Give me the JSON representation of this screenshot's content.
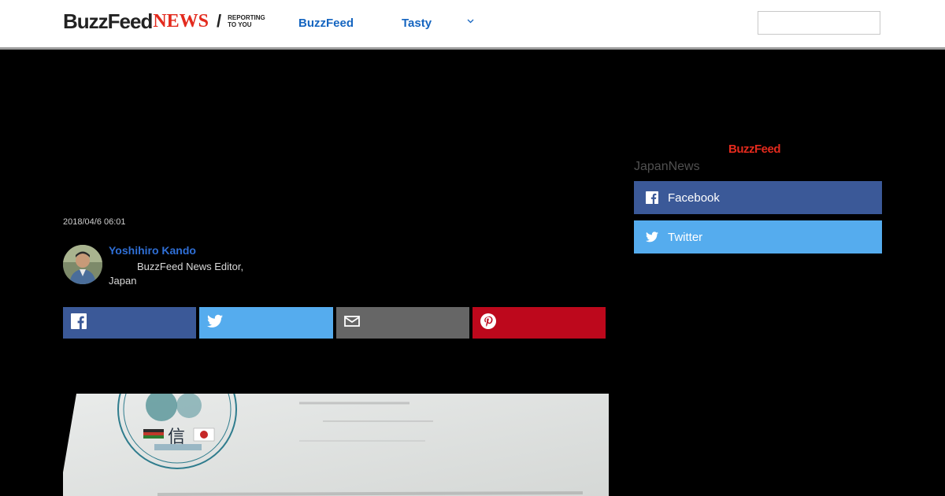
{
  "header": {
    "logo_buzz": "BuzzFeed",
    "logo_news": "NEWS",
    "logo_slash": "/",
    "logo_tagline_line1": "REPORTING",
    "logo_tagline_line2": "TO YOU",
    "nav": [
      {
        "label": "BuzzFeed"
      },
      {
        "label": "Tasty"
      }
    ],
    "search": {
      "value": "",
      "placeholder": ""
    }
  },
  "article": {
    "timestamp": "2018/04/6 06:01",
    "author": {
      "name": "Yoshihiro Kando",
      "title": "BuzzFeed News Editor, Japan"
    },
    "share_buttons": [
      {
        "network": "facebook",
        "icon": "facebook-icon",
        "color": "#3b5998"
      },
      {
        "network": "twitter",
        "icon": "twitter-icon",
        "color": "#55acee"
      },
      {
        "network": "email",
        "icon": "email-icon",
        "color": "#666666"
      },
      {
        "network": "pinterest",
        "icon": "pinterest-icon",
        "color": "#bd081c"
      }
    ]
  },
  "sidebar": {
    "logo": "BuzzFeed",
    "label": "JapanNews",
    "follow_buttons": [
      {
        "label": "Facebook",
        "icon": "facebook-icon",
        "color": "#3b5998"
      },
      {
        "label": "Twitter",
        "icon": "twitter-icon",
        "color": "#55acee"
      }
    ]
  },
  "colors": {
    "brand_red": "#e32a1d",
    "link_blue": "#1565c0",
    "page_background": "#000000"
  }
}
